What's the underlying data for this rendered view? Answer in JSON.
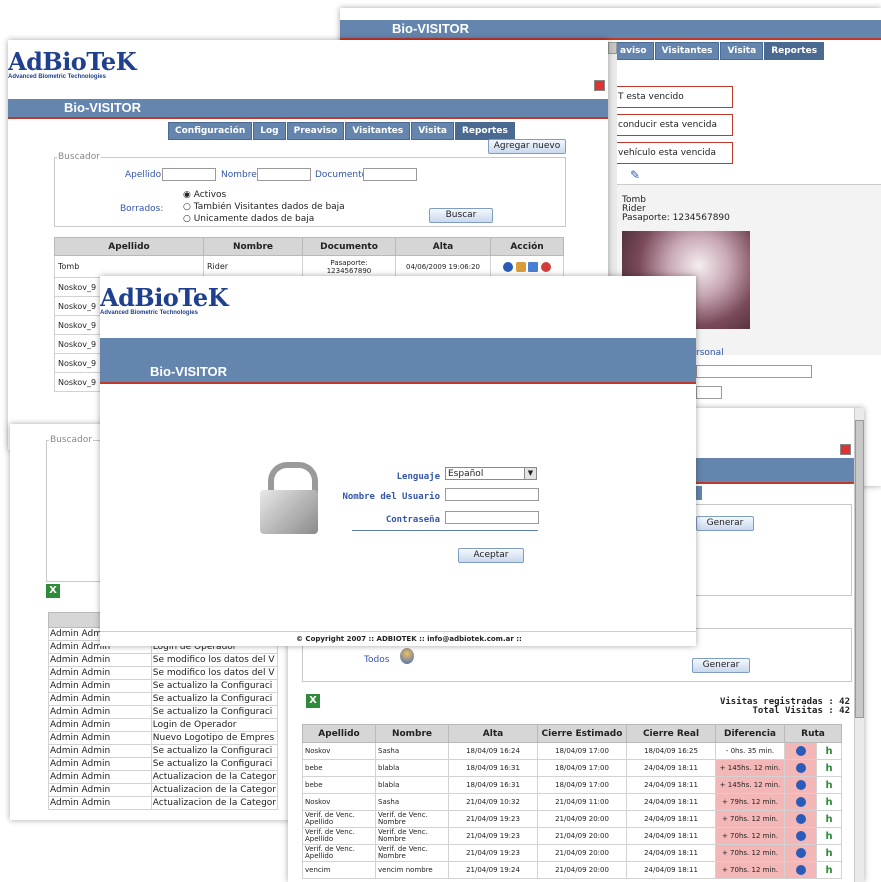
{
  "back_window": {
    "title": "Bio-VISITOR",
    "tabs": [
      "aviso",
      "Visitantes",
      "Visita",
      "Reportes"
    ],
    "alerts": [
      "T esta vencido",
      "conducir esta vencida",
      "vehículo esta vencida"
    ],
    "person": {
      "line1": "Tomb",
      "line2": "Rider",
      "line3": "Pasaporte: 1234567890"
    },
    "link_text": "rsonal",
    "generar_label": "Generar"
  },
  "mid_window": {
    "logo_text": "AdBioTeK",
    "logo_sub": "Advanced Biometric Technologies",
    "title": "Bio-VISITOR",
    "tabs": [
      "Configuración",
      "Log",
      "Preaviso",
      "Visitantes",
      "Visita",
      "Reportes"
    ],
    "add_button": "Agregar nuevo",
    "buscador": {
      "legend": "Buscador",
      "apellido_label": "Apellido:",
      "nombre_label": "Nombre:",
      "documento_label": "Documento:",
      "borrados_label": "Borrados:",
      "radios": [
        "Activos",
        "También Visitantes dados de baja",
        "Unicamente dados de baja"
      ],
      "search_button": "Buscar"
    },
    "table": {
      "headers": [
        "Apellido",
        "Nombre",
        "Documento",
        "Alta",
        "Acción"
      ],
      "first_row": {
        "apellido": "Tomb",
        "nombre": "Rider",
        "documento_line1": "Pasaporte:",
        "documento_line2": "1234567890",
        "alta": "04/06/2009 19:06:20"
      },
      "rows": [
        "Noskov_9",
        "Noskov_9",
        "Noskov_9",
        "Noskov_9",
        "Noskov_9",
        "Noskov_9"
      ]
    }
  },
  "log_window": {
    "buscador_legend": "Buscador",
    "header": "Oper",
    "rows": [
      {
        "op": "Admin Admin",
        "desc": ""
      },
      {
        "op": "Admin Admin",
        "desc": "Login de Operador"
      },
      {
        "op": "Admin Admin",
        "desc": "Se modifico los datos del V"
      },
      {
        "op": "Admin Admin",
        "desc": "Se modifico los datos del V"
      },
      {
        "op": "Admin Admin",
        "desc": "Se actualizo la Configuraci"
      },
      {
        "op": "Admin Admin",
        "desc": "Se actualizo la Configuraci"
      },
      {
        "op": "Admin Admin",
        "desc": "Se actualizo la Configuraci"
      },
      {
        "op": "Admin Admin",
        "desc": "Login de Operador"
      },
      {
        "op": "Admin Admin",
        "desc": "Nuevo Logotipo de Empres"
      },
      {
        "op": "Admin Admin",
        "desc": "Se actualizo la Configuraci"
      },
      {
        "op": "Admin Admin",
        "desc": "Se actualizo la Configuraci"
      },
      {
        "op": "Admin Admin",
        "desc": "Actualizacion de la Categor"
      },
      {
        "op": "Admin Admin",
        "desc": "Actualizacion de la Categor"
      },
      {
        "op": "Admin Admin",
        "desc": "Actualizacion de la Categor"
      }
    ]
  },
  "report_window": {
    "generar_top": "Generar",
    "generar_bottom": "Generar",
    "todos_label": "Todos",
    "visitas_registradas": "Visitas registradas : 42",
    "total_visitas": "Total Visitas : 42",
    "headers": [
      "Apellido",
      "Nombre",
      "Alta",
      "Cierre Estimado",
      "Cierre Real",
      "Diferencia",
      "Ruta"
    ],
    "rows": [
      {
        "apellido": "Noskov",
        "nombre": "Sasha",
        "alta": "18/04/09 16:24",
        "estimado": "18/04/09 17:00",
        "real": "18/04/09 16:25",
        "diff": "- 0hs. 35 min.",
        "neg": true
      },
      {
        "apellido": "bebe",
        "nombre": "blabla",
        "alta": "18/04/09 16:31",
        "estimado": "18/04/09 17:00",
        "real": "24/04/09 18:11",
        "diff": "+ 145hs. 12 min.",
        "neg": false
      },
      {
        "apellido": "bebe",
        "nombre": "blabla",
        "alta": "18/04/09 16:31",
        "estimado": "18/04/09 17:00",
        "real": "24/04/09 18:11",
        "diff": "+ 145hs. 12 min.",
        "neg": false
      },
      {
        "apellido": "Noskov",
        "nombre": "Sasha",
        "alta": "21/04/09 10:32",
        "estimado": "21/04/09 11:00",
        "real": "24/04/09 18:11",
        "diff": "+ 79hs. 12 min.",
        "neg": false
      },
      {
        "apellido": "Verif. de Venc. Apellido",
        "nombre": "Verif. de Venc. Nombre",
        "alta": "21/04/09 19:23",
        "estimado": "21/04/09 20:00",
        "real": "24/04/09 18:11",
        "diff": "+ 70hs. 12 min.",
        "neg": false
      },
      {
        "apellido": "Verif. de Venc. Apellido",
        "nombre": "Verif. de Venc. Nombre",
        "alta": "21/04/09 19:23",
        "estimado": "21/04/09 20:00",
        "real": "24/04/09 18:11",
        "diff": "+ 70hs. 12 min.",
        "neg": false
      },
      {
        "apellido": "Verif. de Venc. Apellido",
        "nombre": "Verif. de Venc. Nombre",
        "alta": "21/04/09 19:23",
        "estimado": "21/04/09 20:00",
        "real": "24/04/09 18:11",
        "diff": "+ 70hs. 12 min.",
        "neg": false
      },
      {
        "apellido": "vencim",
        "nombre": "vencim nombre",
        "alta": "21/04/09 19:24",
        "estimado": "21/04/09 20:00",
        "real": "24/04/09 18:11",
        "diff": "+ 70hs. 12 min.",
        "neg": false
      }
    ]
  },
  "login_window": {
    "logo_text": "AdBioTeK",
    "logo_sub": "Advanced Biometric Technologies",
    "title": "Bio-VISITOR",
    "lenguaje_label": "Lenguaje",
    "lenguaje_value": "Español",
    "usuario_label": "Nombre del Usuario",
    "password_label": "Contraseña",
    "accept_button": "Aceptar",
    "footer": "© Copyright 2007 :: ADBIOTEK :: info@adbiotek.com.ar ::"
  },
  "colors": {
    "band": "#6485ad",
    "accent_red": "#c0392b",
    "diff_red": "#f4b7b7"
  }
}
